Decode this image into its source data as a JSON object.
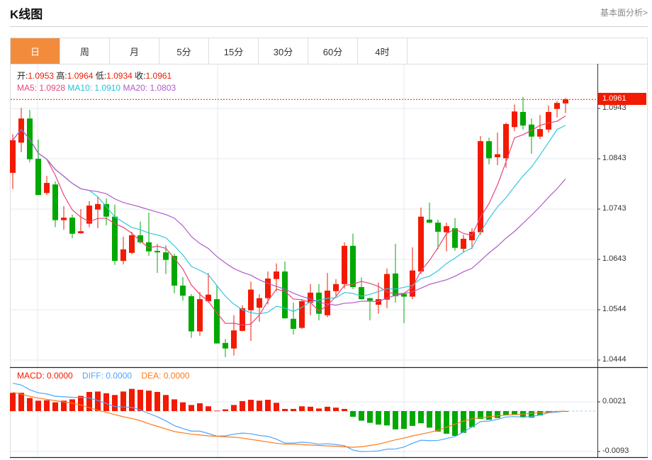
{
  "header": {
    "title": "K线图",
    "fundamental_link": "基本面分析>"
  },
  "tabs": [
    {
      "label": "日",
      "active": true
    },
    {
      "label": "周"
    },
    {
      "label": "月"
    },
    {
      "label": "5分"
    },
    {
      "label": "15分"
    },
    {
      "label": "30分"
    },
    {
      "label": "60分"
    },
    {
      "label": "4时"
    }
  ],
  "info": {
    "open_label": "开:",
    "open": "1.0953",
    "high_label": "高:",
    "high": "1.0964",
    "low_label": "低:",
    "low": "1.0934",
    "close_label": "收:",
    "close": "1.0961",
    "ma5": "MA5: 1.0928",
    "ma10": "MA10: 1.0910",
    "ma20": "MA20: 1.0803"
  },
  "macd_info": {
    "macd": "MACD: 0.0000",
    "diff": "DIFF: 0.0000",
    "dea": "DEA: 0.0000"
  },
  "colors": {
    "up": "#f21a00",
    "down": "#00a800",
    "ma5": "#e8457a",
    "ma10": "#33c6e0",
    "ma20": "#b05bc8",
    "diff": "#4da6ff",
    "dea": "#ff7a1a",
    "active_tab": "#f28c3c"
  },
  "chart_data": [
    {
      "type": "candlestick",
      "yaxis_ticks": [
        "1.0943",
        "1.0843",
        "1.0743",
        "1.0643",
        "1.0544",
        "1.0444"
      ],
      "ylim": [
        1.043,
        1.0995
      ],
      "last_price": "1.0961",
      "ohlc": [
        [
          1.0815,
          1.0892,
          1.0783,
          1.088
        ],
        [
          1.0875,
          1.0944,
          1.0856,
          1.0923
        ],
        [
          1.0923,
          1.094,
          1.0836,
          1.0842
        ],
        [
          1.0843,
          1.0881,
          1.0771,
          1.0771
        ],
        [
          1.0775,
          1.0809,
          1.0771,
          1.0795
        ],
        [
          1.0792,
          1.0798,
          1.0707,
          1.0721
        ],
        [
          1.0721,
          1.0749,
          1.0702,
          1.0726
        ],
        [
          1.0726,
          1.0732,
          1.0685,
          1.0694
        ],
        [
          1.0695,
          1.0743,
          1.0694,
          1.0699
        ],
        [
          1.0714,
          1.0759,
          1.0707,
          1.075
        ],
        [
          1.0742,
          1.0767,
          1.0705,
          1.0753
        ],
        [
          1.0753,
          1.0764,
          1.0711,
          1.0728
        ],
        [
          1.0728,
          1.0752,
          1.0632,
          1.064
        ],
        [
          1.064,
          1.0688,
          1.0633,
          1.0663
        ],
        [
          1.0656,
          1.0698,
          1.0653,
          1.0691
        ],
        [
          1.0691,
          1.0718,
          1.0674,
          1.0677
        ],
        [
          1.0677,
          1.0736,
          1.065,
          1.0659
        ],
        [
          1.066,
          1.0674,
          1.0616,
          1.0657
        ],
        [
          1.0657,
          1.0671,
          1.0614,
          1.0642
        ],
        [
          1.065,
          1.0654,
          1.0576,
          1.0591
        ],
        [
          1.0591,
          1.0608,
          1.0561,
          1.0571
        ],
        [
          1.057,
          1.0574,
          1.0487,
          1.05
        ],
        [
          1.05,
          1.0578,
          1.0491,
          1.0564
        ],
        [
          1.056,
          1.0616,
          1.0557,
          1.0573
        ],
        [
          1.0564,
          1.0591,
          1.0476,
          1.0476
        ],
        [
          1.0477,
          1.0485,
          1.0449,
          1.0466
        ],
        [
          1.0466,
          1.0532,
          1.0452,
          1.0502
        ],
        [
          1.0501,
          1.0552,
          1.05,
          1.0546
        ],
        [
          1.0542,
          1.0599,
          1.0481,
          1.0583
        ],
        [
          1.0547,
          1.0574,
          1.0519,
          1.0566
        ],
        [
          1.0566,
          1.0619,
          1.0554,
          1.0605
        ],
        [
          1.0604,
          1.0635,
          1.058,
          1.0619
        ],
        [
          1.0619,
          1.0639,
          1.0525,
          1.0526
        ],
        [
          1.0525,
          1.0557,
          1.0494,
          1.0505
        ],
        [
          1.0507,
          1.0563,
          1.0505,
          1.056
        ],
        [
          1.0557,
          1.0594,
          1.0532,
          1.0577
        ],
        [
          1.0577,
          1.0594,
          1.0522,
          1.0535
        ],
        [
          1.0532,
          1.0616,
          1.0528,
          1.0581
        ],
        [
          1.058,
          1.0604,
          1.0571,
          1.0594
        ],
        [
          1.0594,
          1.0677,
          1.0585,
          1.067
        ],
        [
          1.067,
          1.0694,
          1.0584,
          1.0588
        ],
        [
          1.0588,
          1.0607,
          1.0563,
          1.0564
        ],
        [
          1.0566,
          1.0567,
          1.0522,
          1.0561
        ],
        [
          1.0553,
          1.0597,
          1.0535,
          1.0564
        ],
        [
          1.0563,
          1.0625,
          1.0546,
          1.0614
        ],
        [
          1.0615,
          1.0674,
          1.0557,
          1.057
        ],
        [
          1.0574,
          1.0577,
          1.0516,
          1.0569
        ],
        [
          1.0569,
          1.0667,
          1.0564,
          1.0621
        ],
        [
          1.0619,
          1.0746,
          1.0614,
          1.0728
        ],
        [
          1.0722,
          1.0756,
          1.0715,
          1.0716
        ],
        [
          1.0716,
          1.0722,
          1.0663,
          1.0698
        ],
        [
          1.0697,
          1.0716,
          1.0659,
          1.0709
        ],
        [
          1.0705,
          1.0725,
          1.066,
          1.0666
        ],
        [
          1.0664,
          1.0692,
          1.0656,
          1.0684
        ],
        [
          1.0681,
          1.0705,
          1.0664,
          1.0698
        ],
        [
          1.0697,
          1.0888,
          1.0692,
          1.0878
        ],
        [
          1.0878,
          1.0885,
          1.0832,
          1.0844
        ],
        [
          1.0846,
          1.0895,
          1.083,
          1.0852
        ],
        [
          1.0844,
          1.0915,
          1.0825,
          1.0912
        ],
        [
          1.0906,
          1.0951,
          1.0898,
          1.0937
        ],
        [
          1.0936,
          1.0966,
          1.0901,
          1.0909
        ],
        [
          1.0911,
          1.0923,
          1.0853,
          1.0887
        ],
        [
          1.0887,
          1.093,
          1.0882,
          1.0902
        ],
        [
          1.0901,
          1.0949,
          1.0895,
          1.0936
        ],
        [
          1.0942,
          1.0958,
          1.0925,
          1.0954
        ],
        [
          1.0953,
          1.0964,
          1.0934,
          1.0961
        ]
      ],
      "moving_averages": [
        5,
        10,
        20
      ]
    },
    {
      "type": "bar",
      "name": "MACD",
      "yaxis_ticks": [
        "0.0021",
        "-0.0093"
      ],
      "macd": [
        0.0042,
        0.0042,
        0.003,
        0.0024,
        0.0025,
        0.002,
        0.0024,
        0.0027,
        0.0035,
        0.0044,
        0.0045,
        0.0041,
        0.0037,
        0.0045,
        0.0051,
        0.0049,
        0.0047,
        0.0044,
        0.0037,
        0.0027,
        0.002,
        0.0014,
        0.0018,
        0.0011,
        0.0001,
        0.0004,
        0.0014,
        0.0023,
        0.0026,
        0.0024,
        0.0026,
        0.0019,
        0.0005,
        0.0005,
        0.0011,
        0.001,
        0.0006,
        0.001,
        0.0008,
        0.0005,
        -0.0013,
        -0.0022,
        -0.0027,
        -0.0031,
        -0.0033,
        -0.0042,
        -0.0041,
        -0.0034,
        -0.0028,
        -0.0038,
        -0.0047,
        -0.0052,
        -0.0057,
        -0.005,
        -0.0037,
        -0.0018,
        -0.002,
        -0.0016,
        -0.0009,
        -0.0009,
        -0.0014,
        -0.0015,
        -0.001,
        -0.0004,
        -0.0002,
        0.0
      ],
      "dea": [
        0.0043,
        0.0039,
        0.0034,
        0.003,
        0.0027,
        0.0024,
        0.0021,
        0.0018,
        0.0014,
        0.0008,
        0.0002,
        -0.0003,
        -0.0008,
        -0.0013,
        -0.0017,
        -0.0022,
        -0.0029,
        -0.0035,
        -0.0041,
        -0.0047,
        -0.005,
        -0.0053,
        -0.0055,
        -0.0057,
        -0.0058,
        -0.0059,
        -0.006,
        -0.0062,
        -0.0065,
        -0.0068,
        -0.0071,
        -0.0074,
        -0.0076,
        -0.0076,
        -0.0077,
        -0.0078,
        -0.0079,
        -0.008,
        -0.0081,
        -0.0082,
        -0.0083,
        -0.0082,
        -0.0079,
        -0.0076,
        -0.0071,
        -0.0066,
        -0.0062,
        -0.0057,
        -0.0053,
        -0.0049,
        -0.0044,
        -0.0037,
        -0.003,
        -0.0023,
        -0.0018,
        -0.0015,
        -0.0013,
        -0.0011,
        -0.0009,
        -0.0008,
        -0.0007,
        -0.0005,
        -0.0004,
        -0.0002,
        -0.0001,
        0.0
      ]
    }
  ]
}
